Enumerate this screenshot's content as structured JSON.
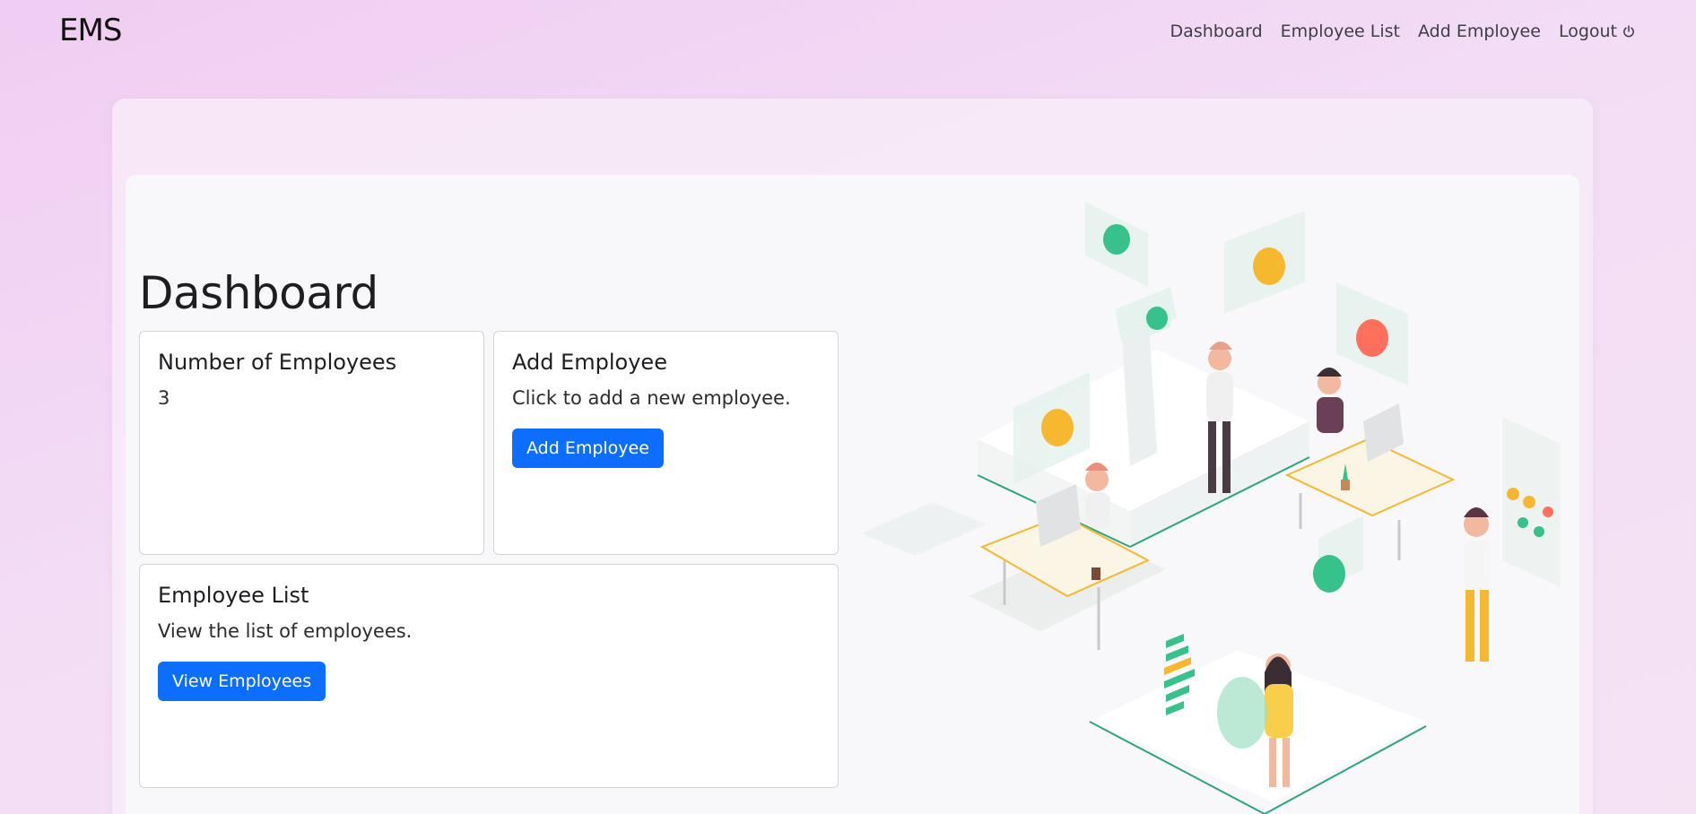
{
  "brand": "EMS",
  "nav": {
    "dashboard": "Dashboard",
    "employee_list": "Employee List",
    "add_employee": "Add Employee",
    "logout": "Logout",
    "logout_icon": "power-icon"
  },
  "page": {
    "title": "Dashboard"
  },
  "cards": {
    "count": {
      "title": "Number of Employees",
      "value": "3"
    },
    "add": {
      "title": "Add Employee",
      "text": "Click to add a new employee.",
      "button": "Add Employee"
    },
    "list": {
      "title": "Employee List",
      "text": "View the list of employees.",
      "button": "View Employees"
    }
  },
  "colors": {
    "primary": "#0d6efd",
    "background": "#f0cdf3",
    "panel": "#f8f8fa"
  },
  "illustration": "isometric-office-team-illustration"
}
